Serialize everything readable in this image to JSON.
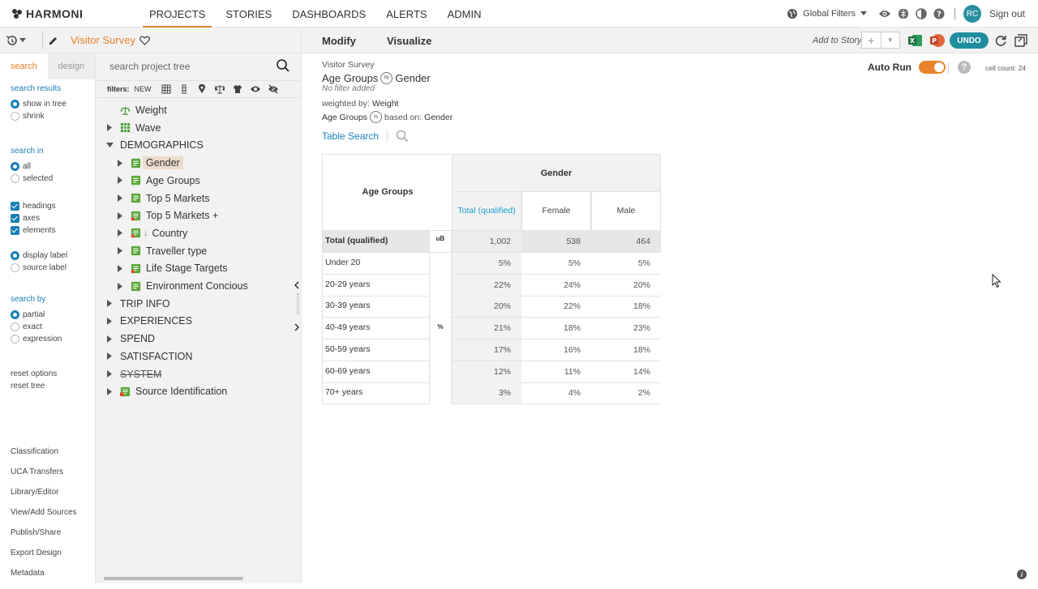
{
  "app": {
    "logo": "HARMONI"
  },
  "nav": {
    "tabs": [
      "PROJECTS",
      "STORIES",
      "DASHBOARDS",
      "ALERTS",
      "ADMIN"
    ],
    "active": "PROJECTS",
    "global_filters": "Global Filters",
    "user_initials": "RC",
    "sign_out": "Sign out"
  },
  "colors": {
    "accent": "#e8832a",
    "link": "#1a7fb5",
    "undo": "#1e8d9e",
    "highlight": "#ecdccc"
  },
  "project": {
    "title": "Visitor Survey"
  },
  "search_panel": {
    "tabs": [
      "search",
      "design"
    ],
    "search_results": {
      "heading": "search results",
      "options": [
        "show in tree",
        "shrink"
      ],
      "selected": "show in tree"
    },
    "search_in": {
      "heading": "search in",
      "options": [
        "all",
        "selected"
      ],
      "selected": "all"
    },
    "checks": [
      "headings",
      "axes",
      "elements"
    ],
    "label_options": [
      "display label",
      "source label"
    ],
    "label_selected": "display label",
    "search_by": {
      "heading": "search by",
      "options": [
        "partial",
        "exact",
        "expression"
      ],
      "selected": "partial"
    },
    "reset_options": "reset options",
    "reset_tree": "reset tree",
    "bottom_links": [
      "Classification",
      "UCA Transfers",
      "Library/Editor",
      "View/Add Sources",
      "Publish/Share",
      "Export Design",
      "Metadata"
    ]
  },
  "tree_panel": {
    "search_placeholder": "search project tree",
    "filters_label": "filters:",
    "filters_new": "NEW",
    "nodes": [
      {
        "label": "Weight",
        "icon": "weight-scale-icon",
        "level": 1,
        "caret": "none"
      },
      {
        "label": "Wave",
        "icon": "grid-table-icon",
        "level": 1,
        "caret": "right"
      },
      {
        "label": "DEMOGRAPHICS",
        "icon": "",
        "level": 0,
        "caret": "down"
      },
      {
        "label": "Gender",
        "icon": "variable-icon",
        "level": 2,
        "caret": "right",
        "selected": true
      },
      {
        "label": "Age Groups",
        "icon": "variable-icon",
        "level": 2,
        "caret": "right"
      },
      {
        "label": "Top 5 Markets",
        "icon": "variable-icon",
        "level": 2,
        "caret": "right"
      },
      {
        "label": "Top 5 Markets +",
        "icon": "variable-derived-icon",
        "level": 2,
        "caret": "right"
      },
      {
        "label": "Country",
        "icon": "variable-sort-icon",
        "level": 2,
        "caret": "right"
      },
      {
        "label": "Traveller type",
        "icon": "variable-icon",
        "level": 2,
        "caret": "right"
      },
      {
        "label": "Life Stage Targets",
        "icon": "variable-derived-icon",
        "level": 2,
        "caret": "right"
      },
      {
        "label": "Environment Concious",
        "icon": "variable-icon",
        "level": 2,
        "caret": "right"
      },
      {
        "label": "TRIP INFO",
        "icon": "",
        "level": 0,
        "caret": "right"
      },
      {
        "label": "EXPERIENCES",
        "icon": "",
        "level": 0,
        "caret": "right"
      },
      {
        "label": "SPEND",
        "icon": "",
        "level": 0,
        "caret": "right"
      },
      {
        "label": "SATISFACTION",
        "icon": "",
        "level": 0,
        "caret": "right"
      },
      {
        "label": "SYSTEM",
        "icon": "",
        "level": 0,
        "caret": "right",
        "strike": true
      },
      {
        "label": "Source Identification",
        "icon": "source-icon",
        "level": 1,
        "caret": "right"
      }
    ]
  },
  "main": {
    "tabs": [
      "Modify",
      "Visualize"
    ],
    "add_to_story": "Add to Story",
    "undo": "UNDO",
    "auto_run": "Auto Run",
    "cell_count": "cell count: 24",
    "meta": {
      "survey": "Visitor Survey",
      "row_var": "Age Groups",
      "col_var": "Gender",
      "by_badge": "by",
      "filter": "No filter added",
      "weighted_label": "weighted by:",
      "weighted_value": "Weight",
      "pct_badge": "%",
      "based_label": "based on:",
      "based_value": "Gender"
    },
    "table_search": "Table Search"
  },
  "crosstab": {
    "row_title": "Age Groups",
    "col_title": "Gender",
    "columns": [
      "Total (qualified)",
      "Female",
      "Male"
    ],
    "total_row": {
      "label": "Total (qualified)",
      "stat": "uB",
      "values": [
        "1,002",
        "538",
        "464"
      ]
    },
    "pct_stat": "%",
    "rows": [
      {
        "label": "Under 20",
        "values": [
          "5%",
          "5%",
          "5%"
        ]
      },
      {
        "label": "20-29 years",
        "values": [
          "22%",
          "24%",
          "20%"
        ]
      },
      {
        "label": "30-39 years",
        "values": [
          "20%",
          "22%",
          "18%"
        ]
      },
      {
        "label": "40-49 years",
        "values": [
          "21%",
          "18%",
          "23%"
        ]
      },
      {
        "label": "50-59 years",
        "values": [
          "17%",
          "16%",
          "18%"
        ]
      },
      {
        "label": "60-69 years",
        "values": [
          "12%",
          "11%",
          "14%"
        ]
      },
      {
        "label": "70+ years",
        "values": [
          "3%",
          "4%",
          "2%"
        ]
      }
    ]
  },
  "footer": {
    "info": "i"
  }
}
